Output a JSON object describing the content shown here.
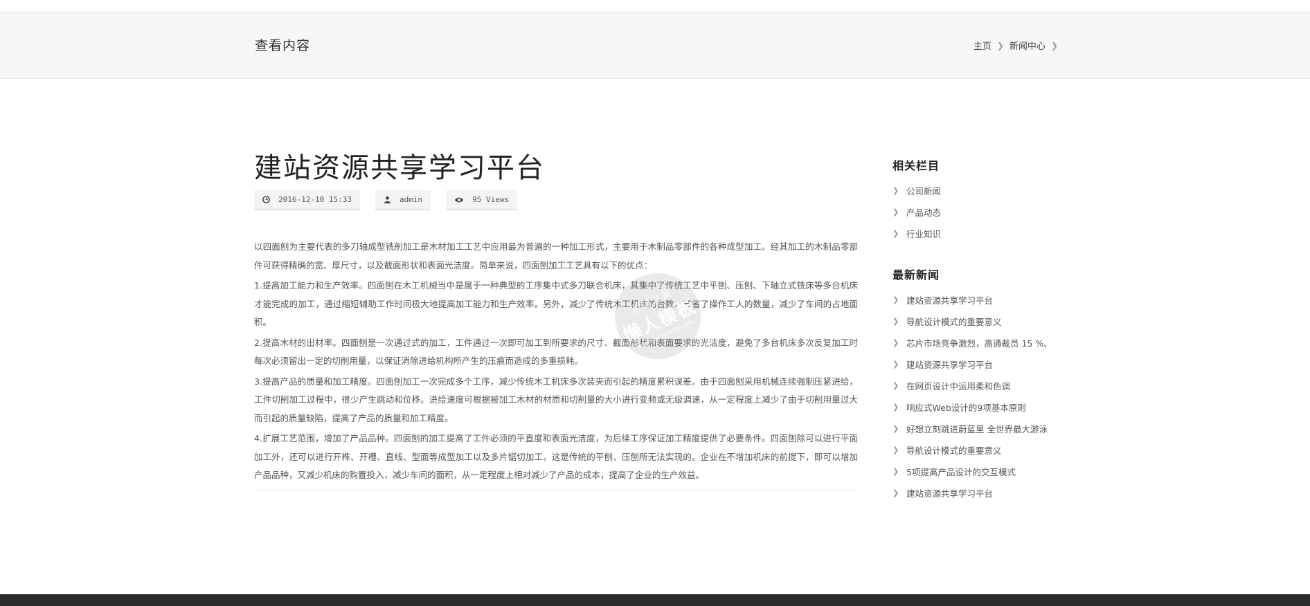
{
  "header": {
    "page_title": "查看内容",
    "breadcrumb": [
      "主页",
      "新闻中心"
    ]
  },
  "article": {
    "title": "建站资源共享学习平台",
    "meta": {
      "date": "2016-12-10 15:33",
      "author": "admin",
      "views": "95 Views"
    },
    "paragraphs": [
      "以四面刨为主要代表的多刀轴成型铣削加工是木材加工工艺中应用最为普遍的一种加工形式，主要用于木制品零部件的各种成型加工。经其加工的木制品零部件可获得精确的宽、厚尺寸，以及截面形状和表面光洁度。简单来说，四面刨加工工艺具有以下的优点：",
      "1.提高加工能力和生产效率。四面刨在木工机械当中是属于一种典型的工序集中式多刀联合机床，其集中了传统工艺中平刨、压刨、下轴立式铣床等多台机床才能完成的加工，通过缩短辅助工作时间极大地提高加工能力和生产效率。另外，减少了传统木工机床的台数，节省了操作工人的数量，减少了车间的占地面积。",
      "2.提高木材的出材率。四面刨是一次通过式的加工，工件通过一次即可加工到所要求的尺寸、截面形状和表面要求的光洁度，避免了多台机床多次反复加工时每次必须留出一定的切削用量，以保证消除进给机构所产生的压痕而造成的多重损耗。",
      "3.提高产品的质量和加工精度。四面刨加工一次完成多个工序，减少传统木工机床多次装夹而引起的精度累积误差。由于四面刨采用机械连续强制压紧进给，工件切削加工过程中，很少产生跳动和位移。进给速度可根据被加工木材的材质和切削量的大小进行变频或无级调速，从一定程度上减少了由于切削用量过大而引起的质量缺陷，提高了产品的质量和加工精度。",
      "4.扩展工艺范围，增加了产品品种。四面刨的加工提高了工件必须的平直度和表面光洁度，为后续工序保证加工精度提供了必要条件。四面刨除可以进行平面加工外，还可以进行开榫、开槽、直线、型面等成型加工以及多片锯切加工，这是传统的平刨、压刨所无法实现的。企业在不增加机床的前提下，即可以增加产品品种，又减少机床的购置投入，减少车间的面积，从一定程度上相对减少了产品的成本，提高了企业的生产效益。"
    ]
  },
  "sidebar": {
    "related_heading": "相关栏目",
    "related_items": [
      "公司新闻",
      "产品动态",
      "行业知识"
    ],
    "news_heading": "最新新闻",
    "news_items": [
      "建站资源共享学习平台",
      "导航设计模式的重要意义",
      "芯片市场竞争激烈，高通裁员 15 %、",
      "建站资源共享学习平台",
      "在网页设计中运用柔和色调",
      "响应式Web设计的9项基本原则",
      "好想立刻跳进蔚蓝里 全世界最大游泳",
      "导航设计模式的重要意义",
      "5项提高产品设计的交互模式",
      "建站资源共享学习平台"
    ]
  },
  "watermark": {
    "line1": "源码之家",
    "line2": "懒人模板",
    "line3": "www.lanrenmb.com"
  }
}
